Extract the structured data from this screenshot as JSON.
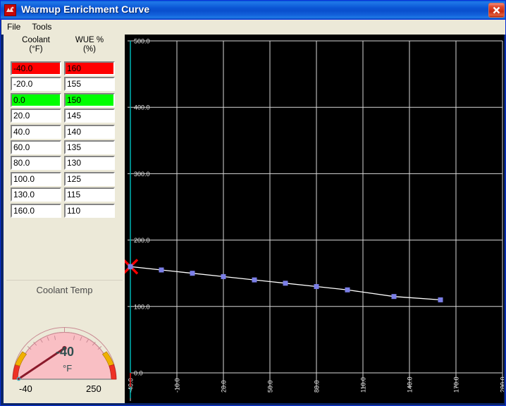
{
  "window": {
    "title": "Warmup Enrichment Curve",
    "icon": "app-icon",
    "close_label": "Close"
  },
  "menu": {
    "items": [
      {
        "label": "File"
      },
      {
        "label": "Tools"
      }
    ]
  },
  "table": {
    "columns": [
      {
        "name": "Coolant",
        "unit": "(°F)"
      },
      {
        "name": "WUE %",
        "unit": "(%)"
      }
    ],
    "rows": [
      {
        "coolant": "-40.0",
        "wue": "160",
        "state": "red"
      },
      {
        "coolant": "-20.0",
        "wue": "155",
        "state": "normal"
      },
      {
        "coolant": "0.0",
        "wue": "150",
        "state": "green"
      },
      {
        "coolant": "20.0",
        "wue": "145",
        "state": "normal"
      },
      {
        "coolant": "40.0",
        "wue": "140",
        "state": "normal"
      },
      {
        "coolant": "60.0",
        "wue": "135",
        "state": "normal"
      },
      {
        "coolant": "80.0",
        "wue": "130",
        "state": "normal"
      },
      {
        "coolant": "100.0",
        "wue": "125",
        "state": "normal"
      },
      {
        "coolant": "130.0",
        "wue": "115",
        "state": "normal"
      },
      {
        "coolant": "160.0",
        "wue": "110",
        "state": "normal"
      }
    ]
  },
  "gauge": {
    "title": "Coolant Temp",
    "value": "-40",
    "units": "°F",
    "min_label": "-40",
    "max_label": "250",
    "face_color": "#f9bfc4",
    "needle_color": "#8b1a2b",
    "warn_color": "#f0b000",
    "alarm_color": "#ee3124"
  },
  "chart_data": {
    "type": "line",
    "title": "",
    "xlabel": "",
    "ylabel": "",
    "x": [
      -40,
      -20,
      0,
      20,
      40,
      60,
      80,
      100,
      130,
      160
    ],
    "values": [
      160,
      155,
      150,
      145,
      140,
      135,
      130,
      125,
      115,
      110
    ],
    "series": [
      {
        "name": "WUE %",
        "values": [
          160,
          155,
          150,
          145,
          140,
          135,
          130,
          125,
          115,
          110
        ]
      }
    ],
    "xlim": [
      -40,
      200
    ],
    "ylim": [
      0,
      500
    ],
    "xticks": [
      -40,
      -10,
      20,
      50,
      80,
      110,
      140,
      170,
      200
    ],
    "xticklabels": [
      "-40.0",
      "-10.0",
      "20.0",
      "50.0",
      "80.0",
      "110.0",
      "140.0",
      "170.0",
      "200.0"
    ],
    "yticks": [
      0,
      100,
      200,
      300,
      400,
      500
    ],
    "yticklabels": [
      "0.0",
      "100.0",
      "200.0",
      "300.0",
      "400.0",
      "500.0"
    ],
    "grid": true,
    "legend": "none",
    "background": "#000000",
    "line_color": "#ffffff",
    "marker_color": "#7b7fe8",
    "selected_index": 0,
    "selected_marker": "red-x",
    "selected_marker_color": "#ff0000",
    "cursor_line_color": "#00c0c0"
  }
}
